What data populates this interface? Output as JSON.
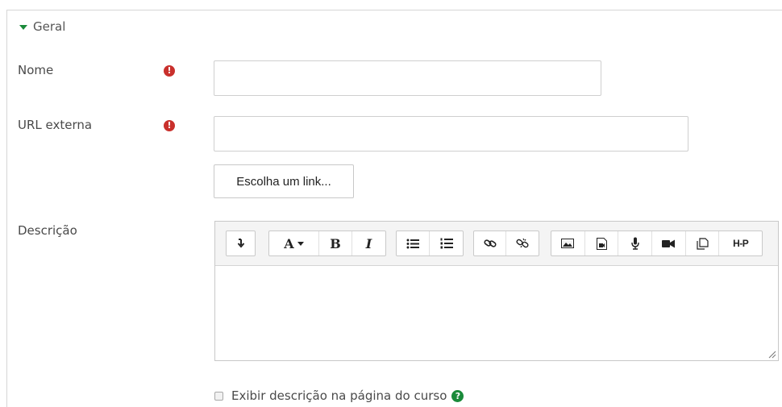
{
  "section": {
    "legend": "Geral"
  },
  "fields": {
    "nome": {
      "label": "Nome",
      "value": "",
      "required_icon": "exclamation-circle-icon"
    },
    "url": {
      "label": "URL externa",
      "value": "",
      "required_icon": "exclamation-circle-icon"
    },
    "choose_link_label": "Escolha um link...",
    "descricao": {
      "label": "Descrição",
      "value": ""
    }
  },
  "toolbar": {
    "groups": [
      [
        "collapse-toolbar-icon"
      ],
      [
        "font-style-icon",
        "bold-icon",
        "italic-icon"
      ],
      [
        "unordered-list-icon",
        "ordered-list-icon"
      ],
      [
        "link-icon",
        "unlink-icon"
      ],
      [
        "image-icon",
        "media-icon",
        "record-audio-icon",
        "record-video-icon",
        "manage-files-icon",
        "h5p-icon"
      ]
    ],
    "labels": {
      "font": "A",
      "bold": "B",
      "italic": "I",
      "h5p": "H-P"
    }
  },
  "show_description": {
    "label": "Exibir descrição na página do curso",
    "checked": false,
    "help_icon": "help-question-icon"
  },
  "colors": {
    "required": "#c9302c",
    "accent": "#1a8a3a",
    "border": "#cfcfcf"
  }
}
